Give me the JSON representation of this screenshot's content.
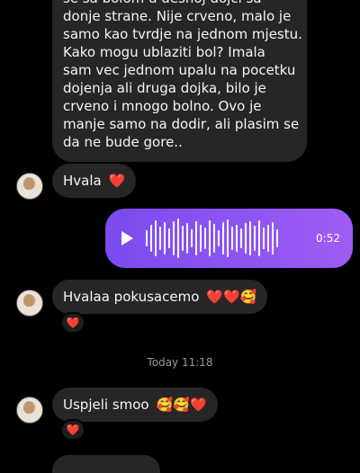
{
  "messages": {
    "first": {
      "lines": [
        "se sa bolom u desnoj dojci sa",
        "donje strane. Nije crveno, malo je",
        "samo kao tvrdje na jednom mjestu.",
        "Kako mogu ublaziti bol? Imala",
        "sam vec jednom upalu na pocetku",
        "dojenja ali druga dojka, bilo je",
        "crveno i mnogo bolno. Ovo je",
        "manje samo na dodir, ali plasim se",
        "da ne bude gore.."
      ]
    },
    "hvala": {
      "text": "Hvala",
      "emoji": "❤️"
    },
    "voice": {
      "duration": "0:52"
    },
    "hvalaa": {
      "text": "Hvalaa pokusacemo",
      "emoji": "❤️❤️🥰",
      "reaction": "❤️"
    },
    "timestamp": "Today 11:18",
    "uspjeli": {
      "text": "Uspjeli smoo",
      "emoji": "🥰🥰❤️",
      "reaction": "❤️"
    }
  },
  "colors": {
    "incoming_bubble": "#262626",
    "outgoing_voice": "#8b52f2",
    "heart": "#ff3040"
  },
  "icons": {
    "play": "play-icon",
    "avatar": "avatar"
  }
}
